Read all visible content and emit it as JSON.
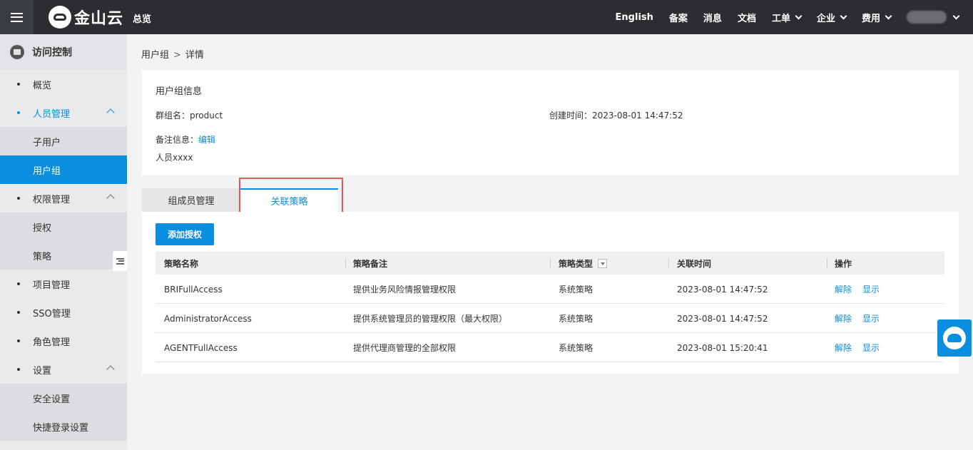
{
  "topbar": {
    "logo_text": "金山云",
    "overview": "总览",
    "nav": [
      {
        "label": "English",
        "has_menu": false
      },
      {
        "label": "备案",
        "has_menu": false
      },
      {
        "label": "消息",
        "has_menu": false
      },
      {
        "label": "文档",
        "has_menu": false
      },
      {
        "label": "工单",
        "has_menu": true
      },
      {
        "label": "企业",
        "has_menu": true
      },
      {
        "label": "费用",
        "has_menu": true
      }
    ]
  },
  "sidebar": {
    "title": "访问控制",
    "items": [
      {
        "label": "概览"
      },
      {
        "label": "人员管理",
        "open": true
      },
      {
        "label": "子用户",
        "sub": true
      },
      {
        "label": "用户组",
        "sub": true,
        "active": true
      },
      {
        "label": "权限管理"
      },
      {
        "label": "授权",
        "sub": true
      },
      {
        "label": "策略",
        "sub": true
      },
      {
        "label": "项目管理"
      },
      {
        "label": "SSO管理"
      },
      {
        "label": "角色管理"
      },
      {
        "label": "设置"
      },
      {
        "label": "安全设置",
        "sub": true
      },
      {
        "label": "快捷登录设置",
        "sub": true
      }
    ]
  },
  "breadcrumb": {
    "parent": "用户组",
    "separator": ">",
    "current": "详情"
  },
  "info": {
    "title": "用户组信息",
    "group_name_label": "群组名：",
    "group_name": "product",
    "created_label": "创建时间：",
    "created": "2023-08-01 14:47:52",
    "remark_label": "备注信息：",
    "edit_link": "编辑",
    "remark": "人员xxxx"
  },
  "tabs": {
    "members": "组成员管理",
    "policies": "关联策略"
  },
  "policies": {
    "add_button": "添加授权",
    "columns": [
      "策略名称",
      "策略备注",
      "策略类型",
      "关联时间",
      "操作"
    ],
    "rows": [
      {
        "name": "BRIFullAccess",
        "remark": "提供业务风险情报管理权限",
        "type": "系统策略",
        "time": "2023-08-01 14:47:52",
        "op1": "解除",
        "op2": "显示"
      },
      {
        "name": "AdministratorAccess",
        "remark": "提供系统管理员的管理权限（最大权限）",
        "type": "系统策略",
        "time": "2023-08-01 14:47:52",
        "op1": "解除",
        "op2": "显示"
      },
      {
        "name": "AGENTFullAccess",
        "remark": "提供代理商管理的全部权限",
        "type": "系统策略",
        "time": "2023-08-01 15:20:41",
        "op1": "解除",
        "op2": "显示"
      }
    ]
  }
}
